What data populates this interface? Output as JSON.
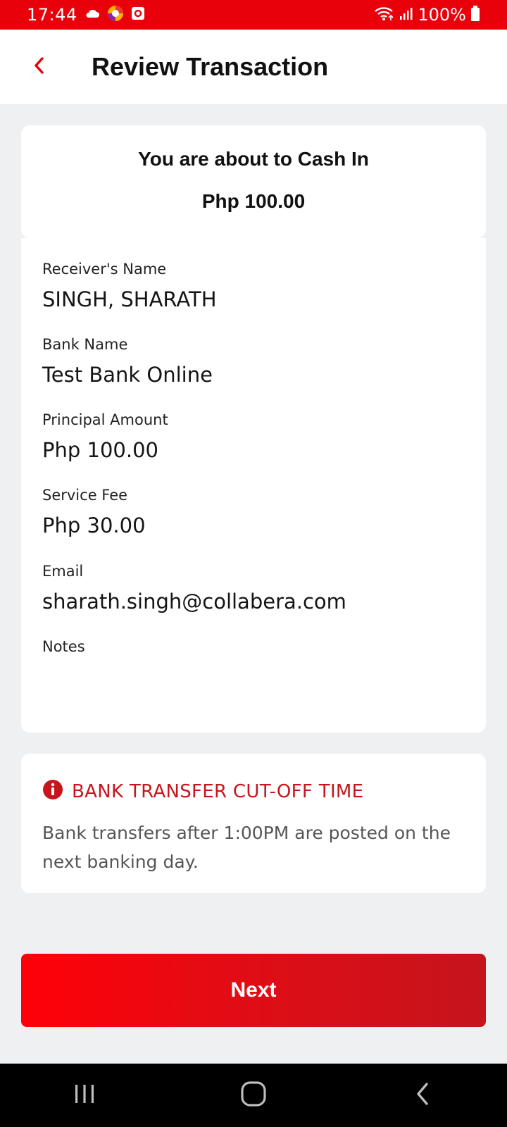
{
  "status_bar": {
    "time": "17:44",
    "battery": "100%",
    "background": "#e8000b"
  },
  "header": {
    "title": "Review Transaction",
    "back_icon": "chevron-left-icon"
  },
  "summary": {
    "title": "You are about to Cash In",
    "amount": "Php 100.00"
  },
  "details": [
    {
      "label": "Receiver's Name",
      "value": "SINGH, SHARATH"
    },
    {
      "label": "Bank Name",
      "value": "Test Bank Online"
    },
    {
      "label": "Principal Amount",
      "value": "Php 100.00"
    },
    {
      "label": "Service Fee",
      "value": "Php 30.00"
    },
    {
      "label": "Email",
      "value": "sharath.singh@collabera.com"
    },
    {
      "label": "Notes",
      "value": ""
    }
  ],
  "notice": {
    "icon": "info-icon",
    "title": "BANK TRANSFER CUT-OFF TIME",
    "body": "Bank transfers after 1:00PM are posted on the next banking day."
  },
  "actions": {
    "next_label": "Next"
  },
  "colors": {
    "accent": "#e8000b",
    "notice_red": "#c8151d"
  }
}
